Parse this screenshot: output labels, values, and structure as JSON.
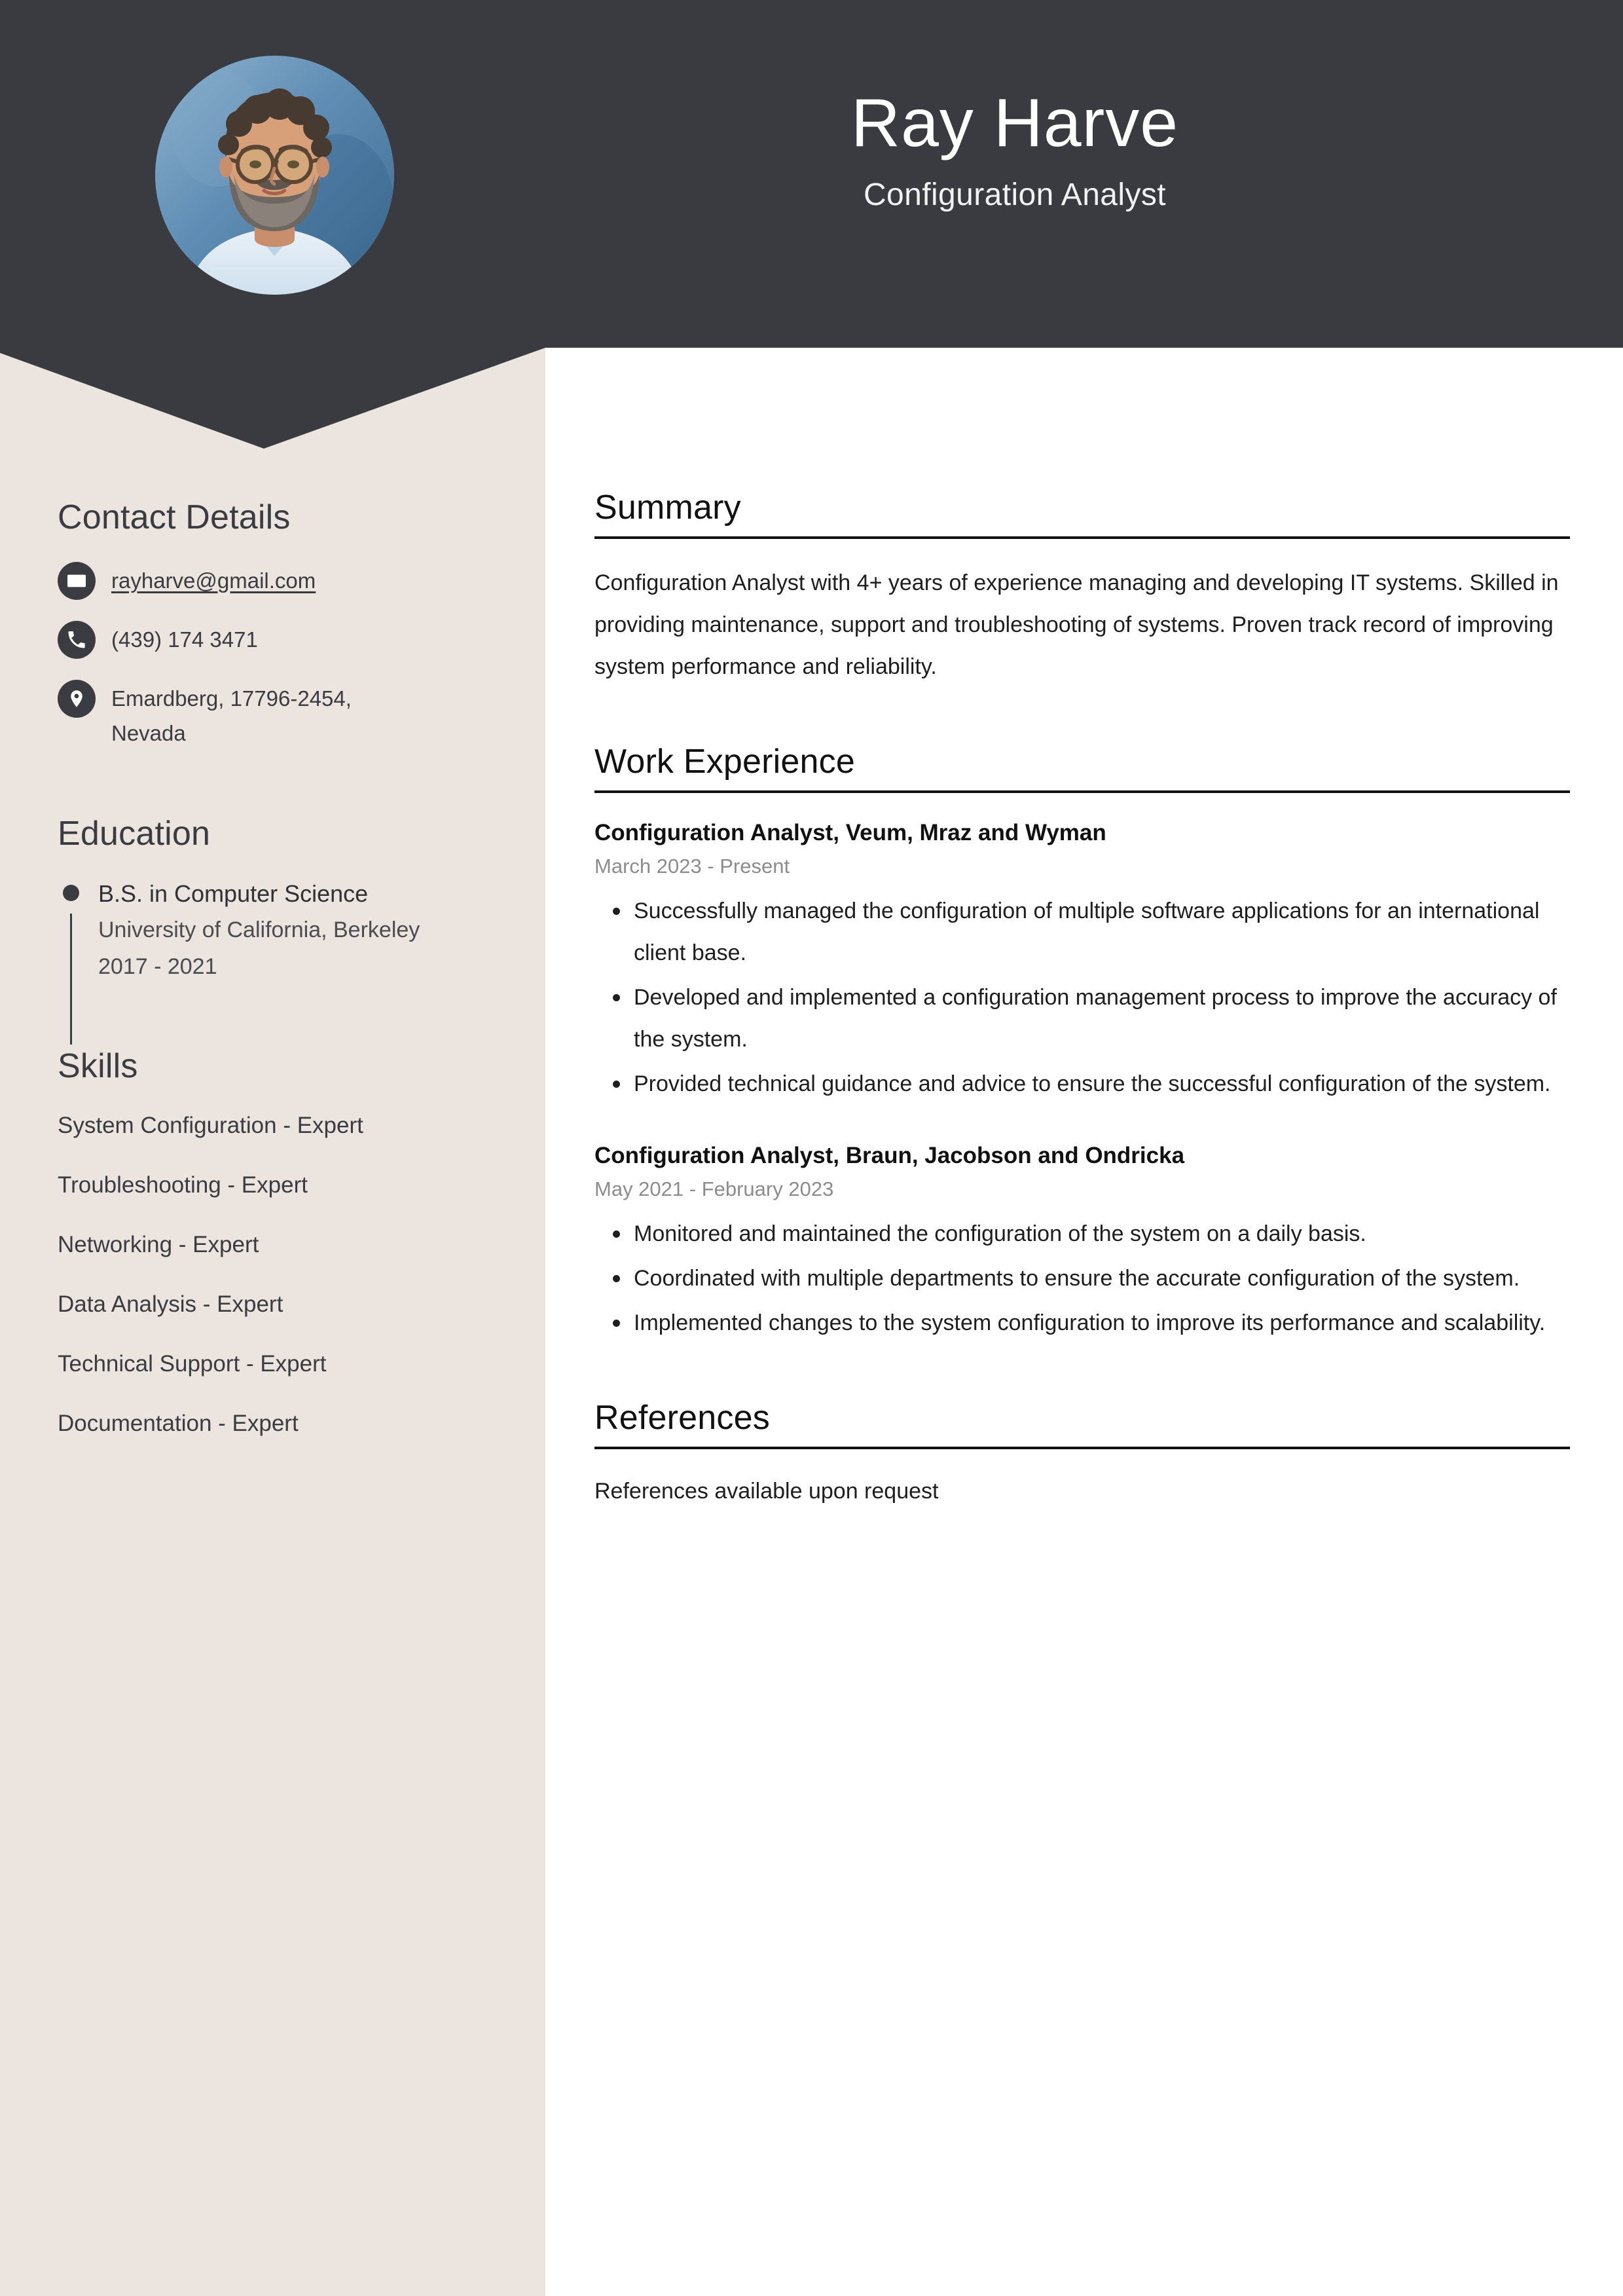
{
  "header": {
    "name": "Ray Harve",
    "job_title": "Configuration Analyst",
    "avatar_alt": "profile-photo",
    "background_color": "#393B40"
  },
  "sidebar": {
    "background_color": "#ECE4DE",
    "contact": {
      "heading": "Contact Details",
      "items": [
        {
          "icon": "envelope-icon",
          "value": "rayharve@gmail.com",
          "is_link": true
        },
        {
          "icon": "phone-icon",
          "value": "(439) 174 3471",
          "is_link": false
        },
        {
          "icon": "map-pin-icon",
          "value": "Emardberg, 17796-2454, Nevada",
          "is_link": false
        }
      ]
    },
    "education": {
      "heading": "Education",
      "items": [
        {
          "degree": "B.S. in Computer Science",
          "school": "University of California, Berkeley",
          "years": "2017 - 2021"
        }
      ]
    },
    "skills": {
      "heading": "Skills",
      "items": [
        "System Configuration - Expert",
        "Troubleshooting - Expert",
        "Networking - Expert",
        "Data Analysis - Expert",
        "Technical Support - Expert",
        "Documentation - Expert"
      ]
    }
  },
  "main": {
    "summary": {
      "heading": "Summary",
      "text": "Configuration Analyst with 4+ years of experience managing and developing IT systems. Skilled in providing maintenance, support and troubleshooting of systems. Proven track record of improving system performance and reliability."
    },
    "work_experience": {
      "heading": "Work Experience",
      "jobs": [
        {
          "title": "Configuration Analyst, Veum, Mraz and Wyman",
          "dates": "March 2023 - Present",
          "bullets": [
            "Successfully managed the configuration of multiple software applications for an international client base.",
            "Developed and implemented a configuration management process to improve the accuracy of the system.",
            "Provided technical guidance and advice to ensure the successful configuration of the system."
          ]
        },
        {
          "title": "Configuration Analyst, Braun, Jacobson and Ondricka",
          "dates": "May 2021 - February 2023",
          "bullets": [
            "Monitored and maintained the configuration of the system on a daily basis.",
            "Coordinated with multiple departments to ensure the accurate configuration of the system.",
            "Implemented changes to the system configuration to improve its performance and scalability."
          ]
        }
      ]
    },
    "references": {
      "heading": "References",
      "text": "References available upon request"
    }
  }
}
